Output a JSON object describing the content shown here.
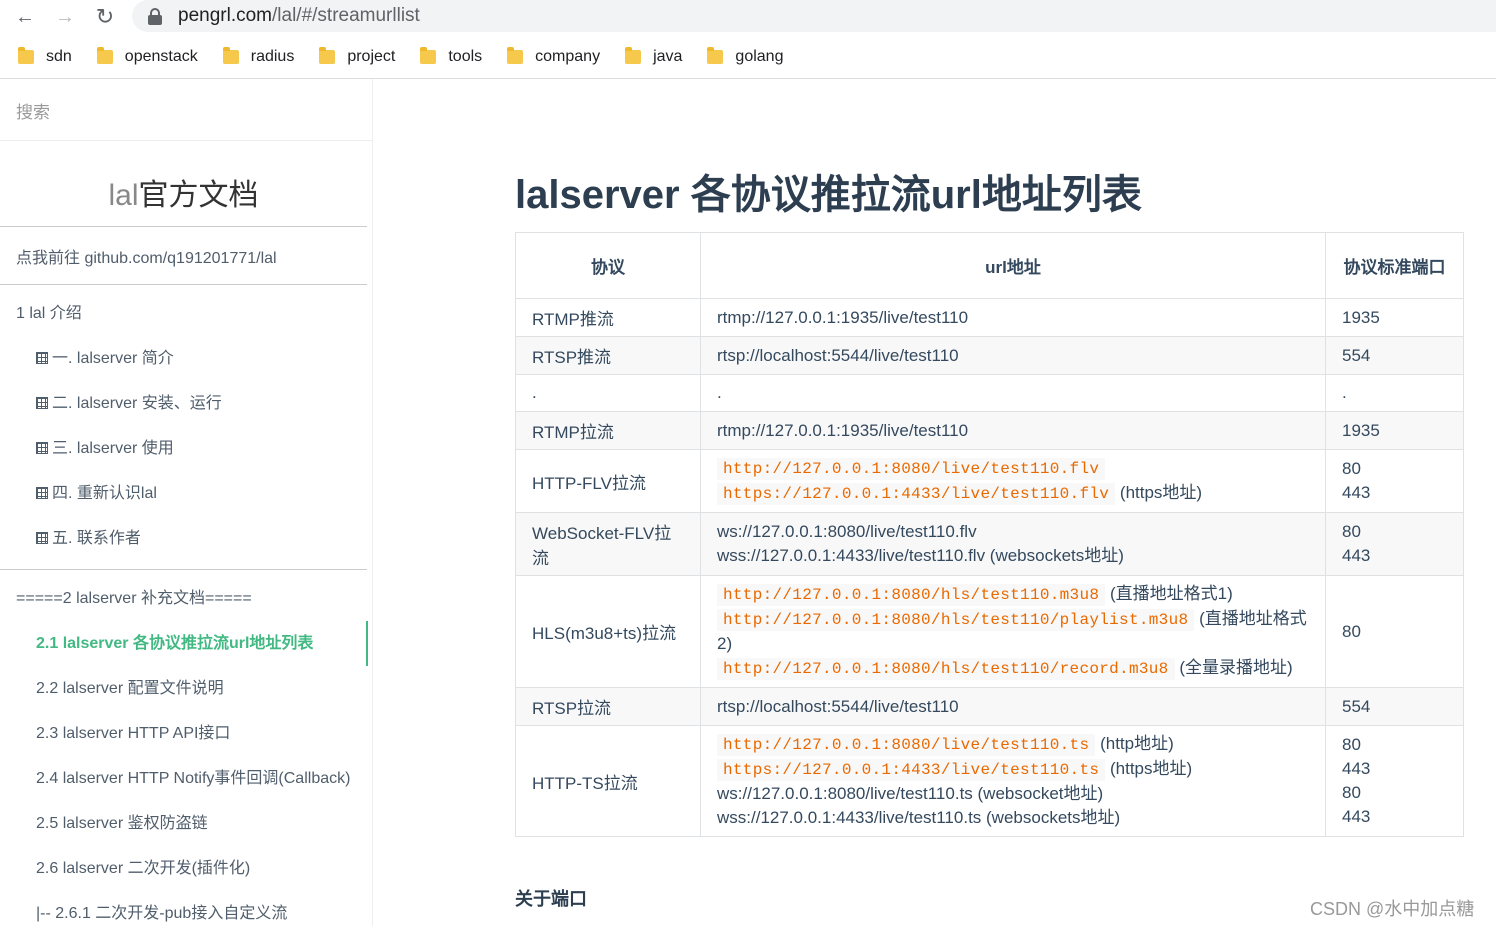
{
  "browser": {
    "url_host": "pengrl.com",
    "url_path": "/lal/#/streamurllist",
    "bookmarks": [
      "sdn",
      "openstack",
      "radius",
      "project",
      "tools",
      "company",
      "java",
      "golang"
    ]
  },
  "sidebar": {
    "search_placeholder": "搜索",
    "app_name_prefix": "lal",
    "app_name_rest": "官方文档",
    "repo_link": "点我前往 github.com/q191201771/lal",
    "toc": [
      {
        "label": "1 lal 介绍",
        "level": 1
      },
      {
        "label": "一. lalserver 简介",
        "level": 2,
        "icon": true
      },
      {
        "label": "二. lalserver 安装、运行",
        "level": 2,
        "icon": true
      },
      {
        "label": "三. lalserver 使用",
        "level": 2,
        "icon": true
      },
      {
        "label": "四. 重新认识lal",
        "level": 2,
        "icon": true
      },
      {
        "label": "五. 联系作者",
        "level": 2,
        "icon": true
      }
    ],
    "toc2": [
      {
        "label": "=====2 lalserver 补充文档=====",
        "level": 1
      },
      {
        "label": "2.1 lalserver 各协议推拉流url地址列表",
        "level": 2,
        "active": true
      },
      {
        "label": "2.2 lalserver 配置文件说明",
        "level": 2
      },
      {
        "label": "2.3 lalserver HTTP API接口",
        "level": 2
      },
      {
        "label": "2.4 lalserver HTTP Notify事件回调(Callback)",
        "level": 2
      },
      {
        "label": "2.5 lalserver 鉴权防盗链",
        "level": 2
      },
      {
        "label": "2.6 lalserver 二次开发(插件化)",
        "level": 2
      },
      {
        "label": "|-- 2.6.1 二次开发-pub接入自定义流",
        "level": 2
      }
    ]
  },
  "main": {
    "title": "lalserver 各协议推拉流url地址列表",
    "table_headers": [
      "协议",
      "url地址",
      "协议标准端口"
    ],
    "rows": [
      {
        "proto": "RTMP推流",
        "lines": [
          {
            "text": "rtmp://127.0.0.1:1935/live/test110"
          }
        ],
        "ports": [
          "1935"
        ]
      },
      {
        "proto": "RTSP推流",
        "lines": [
          {
            "text": "rtsp://localhost:5544/live/test110"
          }
        ],
        "ports": [
          "554"
        ]
      },
      {
        "proto": ".",
        "lines": [
          {
            "text": "."
          }
        ],
        "ports": [
          "."
        ]
      },
      {
        "proto": "RTMP拉流",
        "lines": [
          {
            "text": "rtmp://127.0.0.1:1935/live/test110"
          }
        ],
        "ports": [
          "1935"
        ]
      },
      {
        "proto": "HTTP-FLV拉流",
        "lines": [
          {
            "code": "http://127.0.0.1:8080/live/test110.flv",
            "text": ""
          },
          {
            "code": "https://127.0.0.1:4433/live/test110.flv",
            "text": "(https地址)"
          }
        ],
        "ports": [
          "80",
          "443"
        ]
      },
      {
        "proto": "WebSocket-FLV拉流",
        "lines": [
          {
            "text": "ws://127.0.0.1:8080/live/test110.flv"
          },
          {
            "text": "wss://127.0.0.1:4433/live/test110.flv (websockets地址)"
          }
        ],
        "ports": [
          "80",
          "443"
        ]
      },
      {
        "proto": "HLS(m3u8+ts)拉流",
        "lines": [
          {
            "code": "http://127.0.0.1:8080/hls/test110.m3u8",
            "text": "(直播地址格式1)"
          },
          {
            "code": "http://127.0.0.1:8080/hls/test110/playlist.m3u8",
            "text": "(直播地址格式2)"
          },
          {
            "code": "http://127.0.0.1:8080/hls/test110/record.m3u8",
            "text": "(全量录播地址)"
          }
        ],
        "ports": [
          "80"
        ]
      },
      {
        "proto": "RTSP拉流",
        "lines": [
          {
            "text": "rtsp://localhost:5544/live/test110"
          }
        ],
        "ports": [
          "554"
        ]
      },
      {
        "proto": "HTTP-TS拉流",
        "lines": [
          {
            "code": "http://127.0.0.1:8080/live/test110.ts",
            "text": "(http地址)"
          },
          {
            "code": "https://127.0.0.1:4433/live/test110.ts",
            "text": "(https地址)"
          },
          {
            "text": "ws://127.0.0.1:8080/live/test110.ts (websocket地址)"
          },
          {
            "text": "wss://127.0.0.1:4433/live/test110.ts (websockets地址)"
          }
        ],
        "ports": [
          "80",
          "443",
          "80",
          "443"
        ]
      }
    ],
    "about_heading": "关于端口"
  },
  "watermark": "CSDN @水中加点糖",
  "colors": {
    "accent": "#42b983",
    "code": "#e96900",
    "heading": "#2c3e50"
  }
}
